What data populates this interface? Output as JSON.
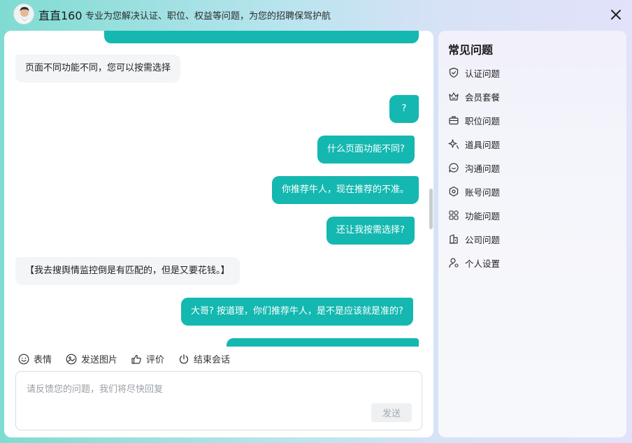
{
  "header": {
    "brand": "直直160",
    "slogan": "专业为您解决认证、职位、权益等问题，为您的招聘保驾护航"
  },
  "messages": [
    {
      "side": "right",
      "text": "",
      "partial": "top"
    },
    {
      "side": "left",
      "text": "页面不同功能不同，您可以按需选择"
    },
    {
      "side": "right",
      "text": "?"
    },
    {
      "side": "right",
      "text": "什么页面功能不同?"
    },
    {
      "side": "right",
      "text": "你推荐牛人，现在推荐的不准。"
    },
    {
      "side": "right",
      "text": "还让我按需选择?"
    },
    {
      "side": "left",
      "text": "【我去搜舆情监控倒是有匹配的，但是又要花钱。】"
    },
    {
      "side": "right",
      "text": "大哥? 按道理，你们推荐牛人，是不是应该就是准的?"
    },
    {
      "side": "right",
      "text": "",
      "partial": "bottom"
    }
  ],
  "toolbar": {
    "emoji_label": "表情",
    "image_label": "发送图片",
    "rate_label": "评价",
    "end_label": "结束会话"
  },
  "input": {
    "placeholder": "请反馈您的问题，我们将尽快回复",
    "value": "",
    "send_label": "发送"
  },
  "faq": {
    "title": "常见问题",
    "items": [
      {
        "label": "认证问题",
        "icon": "shield-check-icon"
      },
      {
        "label": "会员套餐",
        "icon": "crown-icon"
      },
      {
        "label": "职位问题",
        "icon": "briefcase-icon"
      },
      {
        "label": "道具问题",
        "icon": "sparkle-icon"
      },
      {
        "label": "沟通问题",
        "icon": "chat-bubble-icon"
      },
      {
        "label": "账号问题",
        "icon": "account-gear-icon"
      },
      {
        "label": "功能问题",
        "icon": "grid-apps-icon"
      },
      {
        "label": "公司问题",
        "icon": "building-icon"
      },
      {
        "label": "个人设置",
        "icon": "user-settings-icon"
      }
    ]
  },
  "colors": {
    "accent": "#14b8b0",
    "left_bubble": "#f3f5f7"
  }
}
